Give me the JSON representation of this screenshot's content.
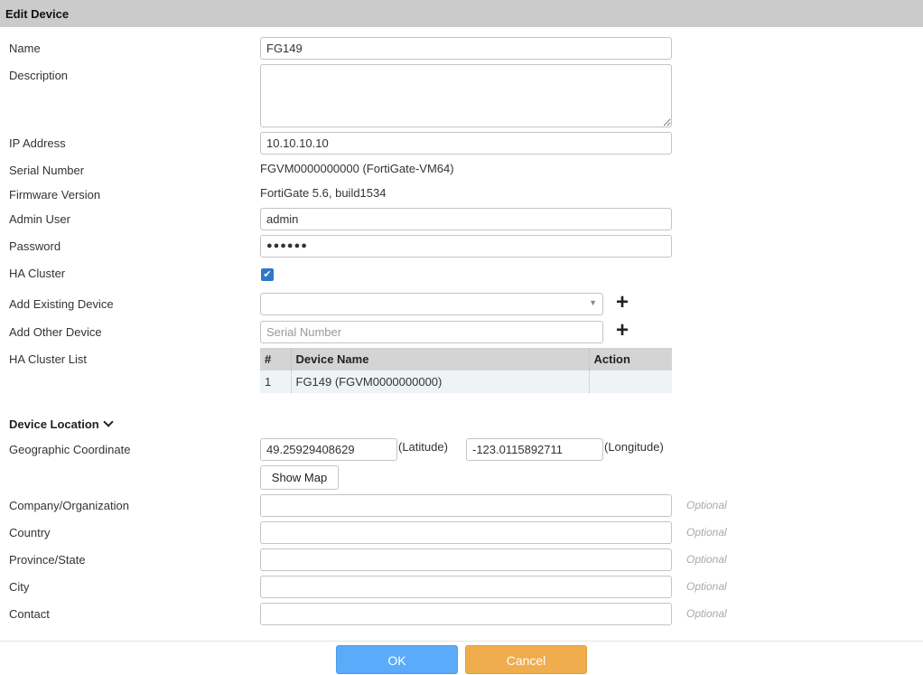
{
  "header": {
    "title": "Edit Device"
  },
  "fields": {
    "name": {
      "label": "Name",
      "value": "FG149"
    },
    "description": {
      "label": "Description",
      "value": ""
    },
    "ip": {
      "label": "IP Address",
      "value": "10.10.10.10"
    },
    "serial": {
      "label": "Serial Number",
      "value": "FGVM0000000000 (FortiGate-VM64)"
    },
    "firmware": {
      "label": "Firmware Version",
      "value": "FortiGate 5.6, build1534"
    },
    "admin": {
      "label": "Admin User",
      "value": "admin"
    },
    "password": {
      "label": "Password",
      "value": "●●●●●●"
    },
    "ha": {
      "label": "HA Cluster",
      "checked": true
    },
    "add_existing": {
      "label": "Add Existing Device",
      "value": ""
    },
    "add_other": {
      "label": "Add Other Device",
      "placeholder": "Serial Number"
    },
    "ha_list": {
      "label": "HA Cluster List",
      "columns": [
        "#",
        "Device Name",
        "Action"
      ],
      "rows": [
        [
          "1",
          "FG149 (FGVM0000000000)",
          ""
        ]
      ]
    }
  },
  "location": {
    "title": "Device Location",
    "geo_label": "Geographic Coordinate",
    "latitude": "49.25929408629",
    "latitude_label": "(Latitude)",
    "longitude": "-123.0115892711",
    "longitude_label": "(Longitude)",
    "show_map": "Show Map",
    "optional": "Optional",
    "company": "Company/Organization",
    "country": "Country",
    "province": "Province/State",
    "city": "City",
    "contact": "Contact"
  },
  "footer": {
    "ok": "OK",
    "cancel": "Cancel"
  }
}
